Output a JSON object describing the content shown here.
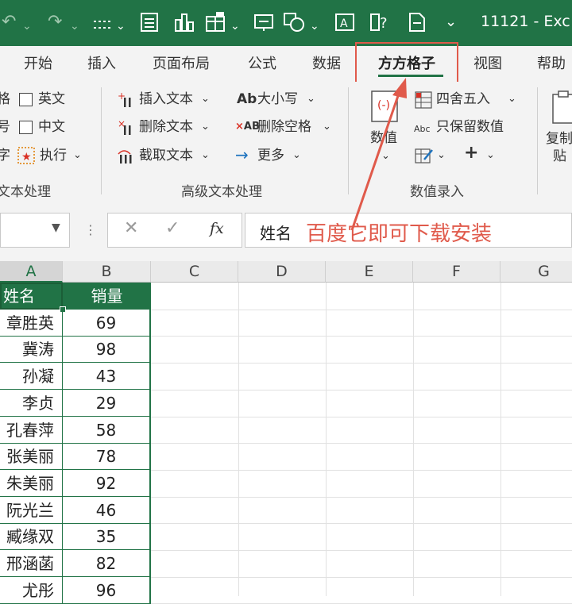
{
  "app": {
    "title": "11121 - Exc",
    "accent": "#217346",
    "annotation_color": "#e05a4b"
  },
  "qat": {
    "icons": [
      "undo-icon",
      "redo-icon",
      "dotted-border-icon",
      "form-icon",
      "chart-icon",
      "table-icon",
      "screen-icon",
      "shapes-icon",
      "text-frame-icon",
      "help-icon",
      "doc-icon",
      "more-icon"
    ]
  },
  "tabs": [
    "开始",
    "插入",
    "页面布局",
    "公式",
    "数据",
    "方方格子",
    "视图",
    "帮助"
  ],
  "active_tab": "方方格子",
  "ribbon": {
    "group1": {
      "partial": [
        "格",
        "号",
        "字"
      ],
      "checks": [
        "英文",
        "中文"
      ],
      "execute": "执行",
      "label": "文本处理",
      "label_prefix": "文"
    },
    "group2": {
      "items": [
        "插入文本",
        "删除文本",
        "截取文本"
      ],
      "items2": [
        "大小写",
        "删除空格",
        "更多"
      ],
      "label": "高级文本处理"
    },
    "group3": {
      "value_btn": "数值",
      "items": [
        "四舍五入",
        "只保留数值"
      ],
      "label": "数值录入"
    },
    "group4": {
      "copy_btn_line1": "复制",
      "copy_btn_line2": "贴"
    }
  },
  "formula": {
    "value": "姓名",
    "annotation": "百度它即可下载安装",
    "fx": "fx"
  },
  "columns": [
    "A",
    "B",
    "C",
    "D",
    "E",
    "F",
    "G"
  ],
  "table": {
    "headers": [
      "姓名",
      "销量"
    ],
    "rows": [
      [
        "章胜英",
        "69"
      ],
      [
        "冀涛",
        "98"
      ],
      [
        "孙凝",
        "43"
      ],
      [
        "李贞",
        "29"
      ],
      [
        "孔春萍",
        "58"
      ],
      [
        "张美丽",
        "78"
      ],
      [
        "朱美丽",
        "92"
      ],
      [
        "阮光兰",
        "46"
      ],
      [
        "臧缘双",
        "35"
      ],
      [
        "邢涵菡",
        "82"
      ],
      [
        "尤彤",
        "96"
      ]
    ]
  }
}
